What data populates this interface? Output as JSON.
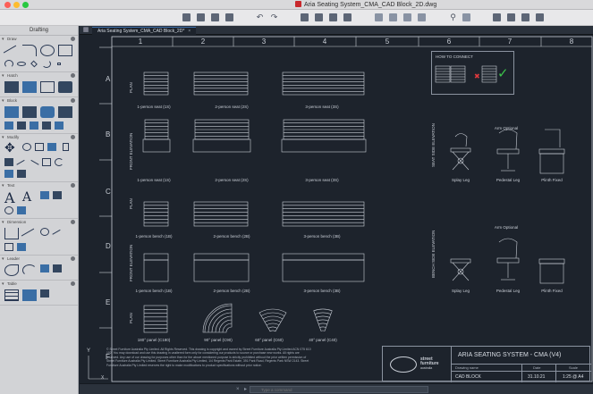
{
  "window": {
    "title": "Aria Seating System_CMA_CAD Block_2D.dwg"
  },
  "palette": {
    "title": "Drafting",
    "sections": [
      {
        "id": "draw",
        "label": "Draw"
      },
      {
        "id": "hatch",
        "label": "Hatch"
      },
      {
        "id": "block",
        "label": "Block"
      },
      {
        "id": "modify",
        "label": "Modify"
      },
      {
        "id": "text",
        "label": "Text"
      },
      {
        "id": "dimension",
        "label": "Dimension"
      },
      {
        "id": "leader",
        "label": "Leader"
      },
      {
        "id": "table",
        "label": "Table"
      }
    ]
  },
  "tabs": [
    {
      "label": "Aria Seating System_CMA_CAD Block_2D*"
    }
  ],
  "drawing": {
    "columns": [
      "1",
      "2",
      "3",
      "4",
      "5",
      "6",
      "7",
      "8"
    ],
    "rows": [
      "A",
      "B",
      "C",
      "D",
      "E",
      "F"
    ],
    "views": {
      "plan": "PLAN",
      "front_elevation": "FRONT ELEVATION",
      "seat_side_elevation": "SEAT SIDE ELEVATION",
      "bench_side_elevation": "BENCH SIDE ELEVATION"
    },
    "labels": {
      "seat1": "1-person seat (1S)",
      "seat2": "2-person seat (2S)",
      "seat3": "3-person seat (3S)",
      "bench1": "1-person bench (1B)",
      "bench2": "2-person bench (2B)",
      "bench3": "3-person bench (3B)",
      "splay": "Splay Leg",
      "pedestal": "Pedestal Leg",
      "plinth": "Plinth Fixed",
      "arm_optional": "Arm Optional",
      "panel180": "180° panel (C180)",
      "panel90": "90° panel (C90)",
      "panel60": "60° panel (C60)",
      "panel40": "40° panel (C40)"
    },
    "how_to_connect": "HOW TO CONNECT",
    "disclaimer": "© Street Furniture Australia Pty Limited. All Rights Reserved. This drawing is copyright and owned by Street Furniture Australia Pty Limited ACN 075 610 102. You may download and use this drawing in unaltered form only for considering our products to source or purchase new works. All rights are reserved. Any use of our drawing for purposes other than for the above mentioned purpose is strictly prohibited without the prior written permission of Street Furniture Australia Pty Limited. Street Furniture Australia Pty Limited, 1/4 Regents Park Estate, 391 Park Road, Regents Park NSW 2143. Street Furniture Australia Pty Limited reserves the right to make modifications to product specifications without prior notice.",
    "title_block": {
      "logo_line1": "street",
      "logo_line2": "furniture",
      "logo_line3": "australia",
      "title": "ARIA SEATING SYSTEM - CMA  (V4)",
      "drawing_name_label": "Drawing name",
      "drawing_name": "CAD BLOCK",
      "date_label": "Date",
      "date": "31.10.21",
      "scale_label": "Scale",
      "scale": "1:25 @ A4"
    },
    "axis_y": "Y",
    "axis_x": "X"
  },
  "command": {
    "placeholder": "Type a command"
  },
  "colors": {
    "canvas_bg": "#1d232c",
    "line": "#c9ced6",
    "accent_check": "#3cc24a",
    "accent_cross": "#e0393e"
  }
}
